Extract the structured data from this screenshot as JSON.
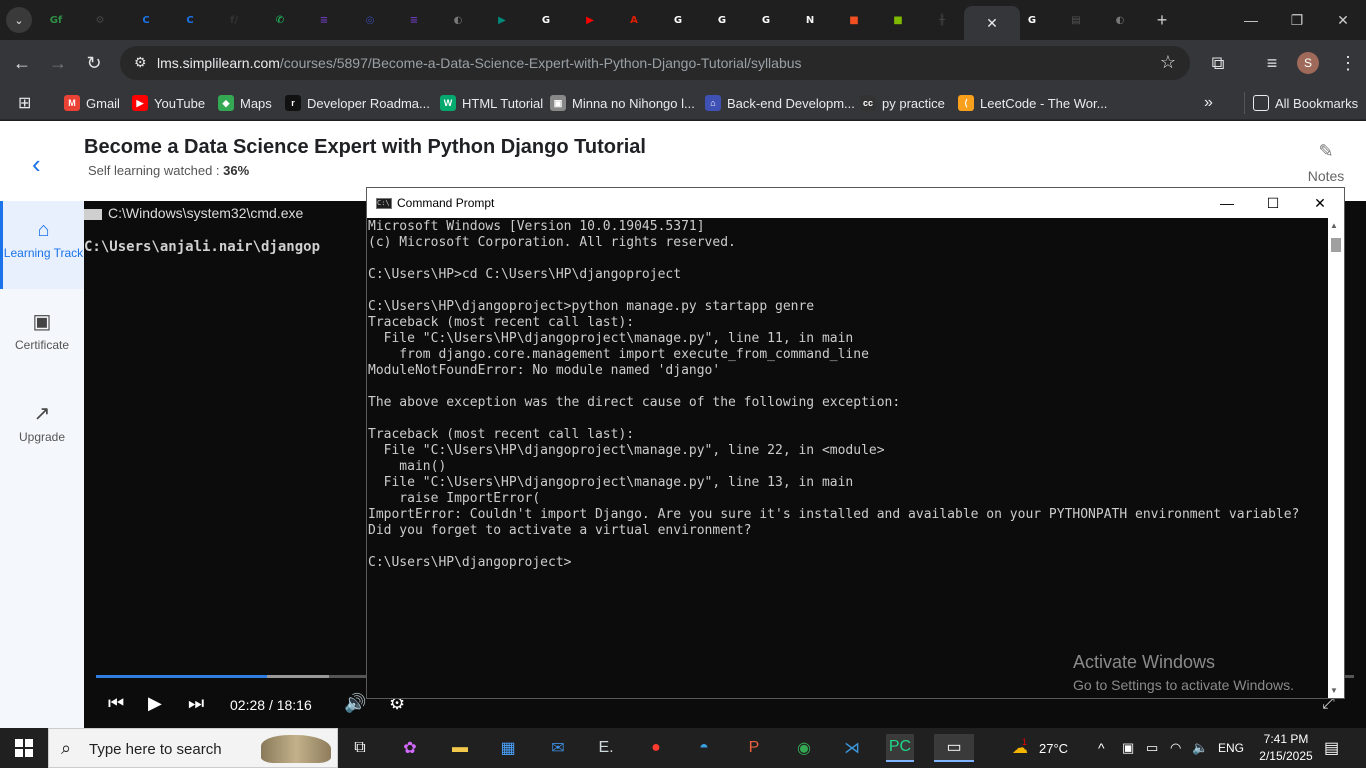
{
  "browser": {
    "url_host": "lms.simplilearn.com",
    "url_path": "/courses/5897/Become-a-Data-Science-Expert-with-Python-Django-Tutorial/syllabus",
    "profile_initial": "S",
    "tabs": [
      {
        "icon": "geeksforgeeks-icon",
        "glyph": "Gf",
        "color": "#2f8d46"
      },
      {
        "icon": "chatgpt-icon",
        "glyph": "⚙",
        "color": "#444"
      },
      {
        "icon": "coursera-icon",
        "glyph": "C",
        "color": "#1a73e8"
      },
      {
        "icon": "coursera-icon",
        "glyph": "C",
        "color": "#1a73e8"
      },
      {
        "icon": "freecodecamp-icon",
        "glyph": "f/",
        "color": "#333"
      },
      {
        "icon": "whatsapp-icon",
        "glyph": "✆",
        "color": "#25d366"
      },
      {
        "icon": "forms-icon",
        "glyph": "≡",
        "color": "#673ab7"
      },
      {
        "icon": "circle-app-icon",
        "glyph": "◎",
        "color": "#3949ab"
      },
      {
        "icon": "forms-icon",
        "glyph": "≡",
        "color": "#673ab7"
      },
      {
        "icon": "globe-icon",
        "glyph": "◐",
        "color": "#777"
      },
      {
        "icon": "meet-icon",
        "glyph": "▶",
        "color": "#00897b"
      },
      {
        "icon": "google-icon",
        "glyph": "G",
        "color": "#ffffff"
      },
      {
        "icon": "youtube-icon",
        "glyph": "▶",
        "color": "#ff0000"
      },
      {
        "icon": "adobe-icon",
        "glyph": "A",
        "color": "#e01e00"
      },
      {
        "icon": "google-icon",
        "glyph": "G",
        "color": "#ffffff"
      },
      {
        "icon": "google-icon",
        "glyph": "G",
        "color": "#ffffff"
      },
      {
        "icon": "google-icon",
        "glyph": "G",
        "color": "#ffffff"
      },
      {
        "icon": "notion-icon",
        "glyph": "N",
        "color": "#f5f5f5"
      },
      {
        "icon": "microsoft-icon",
        "glyph": "■",
        "color": "#f25022"
      },
      {
        "icon": "microsoft-icon",
        "glyph": "■",
        "color": "#7fba00"
      },
      {
        "icon": "chart-icon",
        "glyph": "╫",
        "color": "#444"
      }
    ],
    "active_tab_close": "✕",
    "after_tabs": [
      {
        "icon": "google-icon",
        "glyph": "G",
        "color": "#ffffff"
      },
      {
        "icon": "sheet-icon",
        "glyph": "▤",
        "color": "#555"
      },
      {
        "icon": "globe-icon",
        "glyph": "◐",
        "color": "#777"
      }
    ],
    "new_tab": "+"
  },
  "bookmarks": {
    "apps_icon": "apps-grid-icon",
    "items": [
      {
        "label": "Gmail",
        "glyph": "M",
        "color": "#ea4335"
      },
      {
        "label": "YouTube",
        "glyph": "▶",
        "color": "#ff0000"
      },
      {
        "label": "Maps",
        "glyph": "◆",
        "color": "#34a853"
      },
      {
        "label": "Developer Roadma...",
        "glyph": "r",
        "color": "#111"
      },
      {
        "label": "HTML Tutorial",
        "glyph": "W",
        "color": "#04aa6d"
      },
      {
        "label": "Minna no Nihongo l...",
        "glyph": "▣",
        "color": "#888"
      },
      {
        "label": "Back-end Developm...",
        "glyph": "⌂",
        "color": "#3f51b5"
      },
      {
        "label": "py practice",
        "glyph": "cc",
        "color": "#333"
      },
      {
        "label": "LeetCode - The Wor...",
        "glyph": "⟨",
        "color": "#f89f1b"
      }
    ],
    "overflow": "»",
    "all_bookmarks": "All Bookmarks"
  },
  "course": {
    "title": "Become a Data Science Expert with Python Django Tutorial",
    "watched_label": "Self learning watched : ",
    "watched_value": "36%",
    "notes_label": "Notes"
  },
  "sidebar": {
    "items": [
      {
        "label": "Learning Track",
        "icon": "learning-track-icon"
      },
      {
        "label": "Certificate",
        "icon": "certificate-icon"
      },
      {
        "label": "Upgrade",
        "icon": "upgrade-icon"
      }
    ]
  },
  "video": {
    "inner_window_title": "C:\\Windows\\system32\\cmd.exe",
    "inner_path": "C:\\Users\\anjali.nair\\djangop",
    "current_time": "02:28",
    "separator": "/",
    "duration": "18:16",
    "progress": 0.136,
    "buffered": 0.185
  },
  "cmd": {
    "title": "Command Prompt",
    "lines": [
      "Microsoft Windows [Version 10.0.19045.5371]",
      "(c) Microsoft Corporation. All rights reserved.",
      "",
      "C:\\Users\\HP>cd C:\\Users\\HP\\djangoproject",
      "",
      "C:\\Users\\HP\\djangoproject>python manage.py startapp genre",
      "Traceback (most recent call last):",
      "  File \"C:\\Users\\HP\\djangoproject\\manage.py\", line 11, in main",
      "    from django.core.management import execute_from_command_line",
      "ModuleNotFoundError: No module named 'django'",
      "",
      "The above exception was the direct cause of the following exception:",
      "",
      "Traceback (most recent call last):",
      "  File \"C:\\Users\\HP\\djangoproject\\manage.py\", line 22, in <module>",
      "    main()",
      "  File \"C:\\Users\\HP\\djangoproject\\manage.py\", line 13, in main",
      "    raise ImportError(",
      "ImportError: Couldn't import Django. Are you sure it's installed and available on your PYTHONPATH environment variable?",
      "Did you forget to activate a virtual environment?",
      "",
      "C:\\Users\\HP\\djangoproject>"
    ]
  },
  "watermark": {
    "line1": "Activate Windows",
    "line2": "Go to Settings to activate Windows."
  },
  "taskbar": {
    "search_placeholder": "Type here to search",
    "weather": "27°C",
    "weather_badge": "1",
    "language": "ENG",
    "time": "7:41 PM",
    "date": "2/15/2025"
  }
}
